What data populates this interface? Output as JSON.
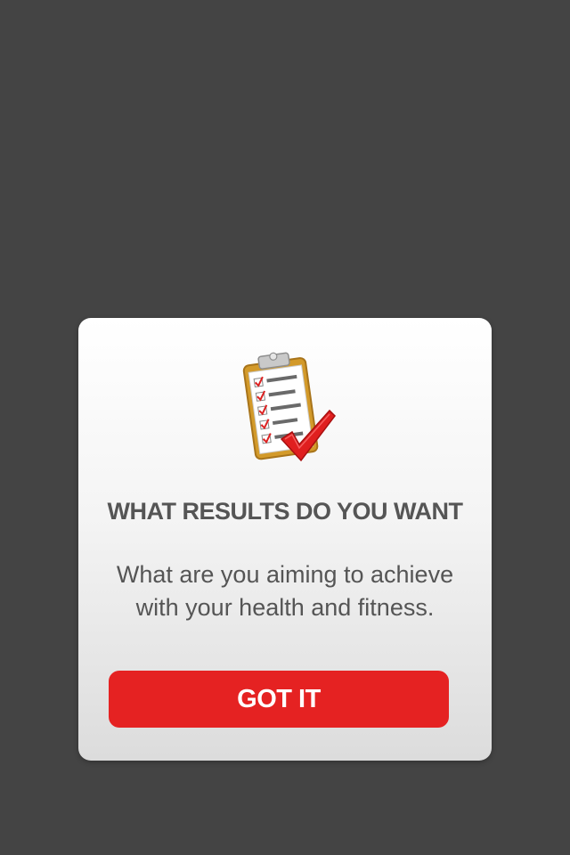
{
  "dialog": {
    "title": "WHAT RESULTS DO YOU WANT",
    "message": "What are you aiming to achieve with your health and fitness.",
    "button_label": "GOT IT",
    "illustration_icon": "clipboard-checklist-icon"
  },
  "colors": {
    "background": "#444444",
    "dialog_top": "#ffffff",
    "dialog_bottom": "#dcdcdc",
    "button": "#e52222",
    "text": "#555555"
  }
}
